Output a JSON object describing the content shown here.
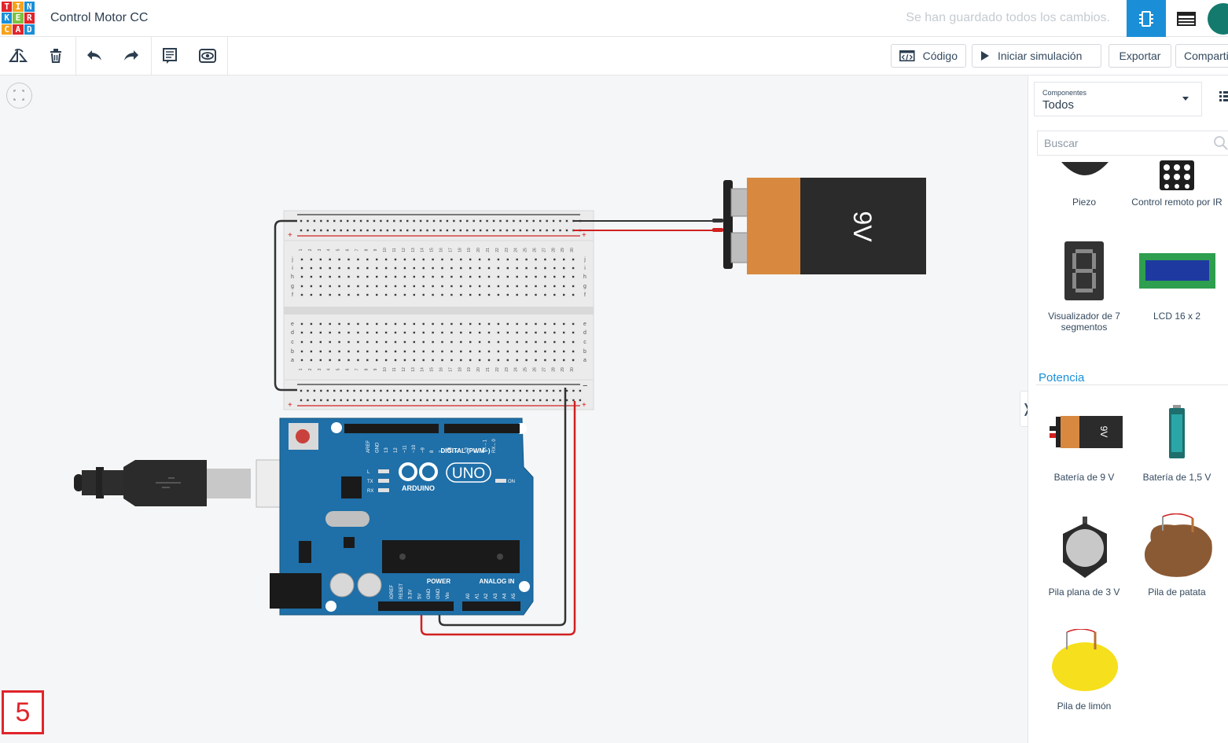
{
  "header": {
    "logo_letters": [
      "T",
      "I",
      "N",
      "K",
      "E",
      "R",
      "C",
      "A",
      "D"
    ],
    "logo_colors": [
      "#e0252b",
      "#f7a21b",
      "#1a8fd8",
      "#1a8fd8",
      "#7cc242",
      "#e0252b",
      "#f7a21b",
      "#e0252b",
      "#1a8fd8"
    ],
    "title": "Control Motor CC",
    "save_status": "Se han guardado todos los cambios.",
    "accent": "#1a8fd8"
  },
  "toolbar": {
    "tools": [
      "rotate-icon",
      "trash-icon",
      "undo-icon",
      "redo-icon",
      "notes-icon",
      "visibility-icon"
    ],
    "code_label": "Código",
    "simulate_label": "Iniciar simulación",
    "export_label": "Exportar",
    "share_label": "Compartir"
  },
  "canvas": {
    "step_number": "5",
    "battery_label": "9V",
    "breadboard_cols": [
      "1",
      "2",
      "3",
      "4",
      "5",
      "6",
      "7",
      "8",
      "9",
      "10",
      "11",
      "12",
      "13",
      "14",
      "15",
      "16",
      "17",
      "18",
      "19",
      "20",
      "21",
      "22",
      "23",
      "24",
      "25",
      "26",
      "27",
      "28",
      "29",
      "30"
    ],
    "breadboard_rows_top": [
      "j",
      "i",
      "h",
      "g",
      "f"
    ],
    "breadboard_rows_bottom": [
      "e",
      "d",
      "c",
      "b",
      "a"
    ],
    "arduino": {
      "brand": "ARDUINO",
      "model": "UNO",
      "digital_label": "DIGITAL (PWM~)",
      "power_label": "POWER",
      "analog_label": "ANALOG IN",
      "on_label": "ON",
      "tx_label": "TX",
      "rx_label": "RX",
      "l_label": "L",
      "top_pins": [
        "AREF",
        "GND",
        "13",
        "12",
        "~11",
        "~10",
        "~9",
        "8",
        "7",
        "~6",
        "~5",
        "4",
        "~3",
        "2",
        "TX→1",
        "RX←0"
      ],
      "power_pins": [
        "IOREF",
        "RESET",
        "3.3V",
        "5V",
        "GND",
        "GND",
        "Vin"
      ],
      "analog_pins": [
        "A0",
        "A1",
        "A2",
        "A3",
        "A4",
        "A5"
      ]
    }
  },
  "panel": {
    "dropdown_caption": "Componentes",
    "dropdown_value": "Todos",
    "search_placeholder": "Buscar",
    "section_title": "Potencia",
    "components_top": [
      {
        "name": "Piezo"
      },
      {
        "name": "Control remoto por IR"
      },
      {
        "name": "Visualizador de 7 segmentos"
      },
      {
        "name": "LCD 16 x 2"
      }
    ],
    "components_power": [
      {
        "name": "Batería de 9 V"
      },
      {
        "name": "Batería de 1,5 V"
      },
      {
        "name": "Pila plana de 3 V"
      },
      {
        "name": "Pila de patata"
      },
      {
        "name": "Pila de limón"
      }
    ],
    "collapse_glyph": "❭"
  }
}
